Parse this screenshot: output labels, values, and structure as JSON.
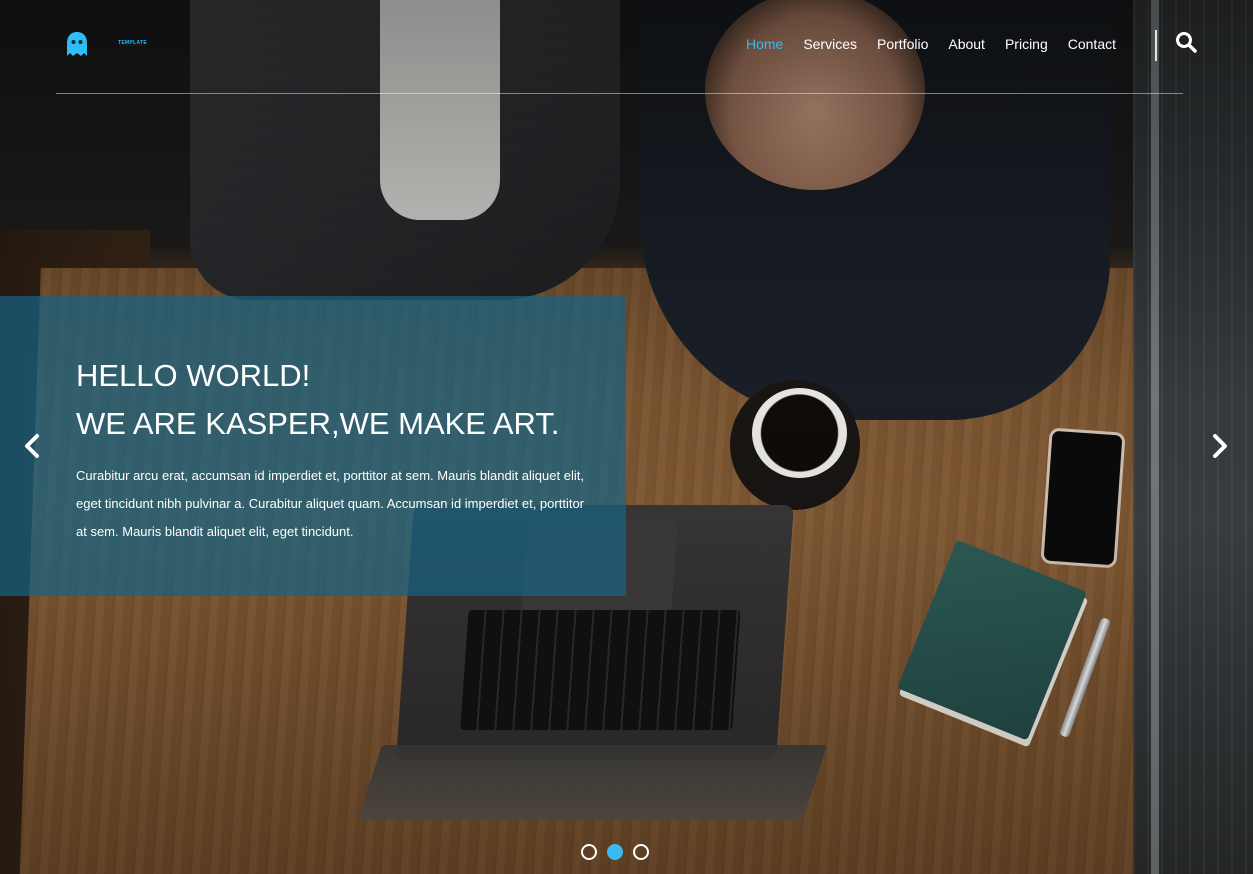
{
  "header": {
    "logo": {
      "text": "TEMPLATE",
      "icon": "ghost-icon",
      "color": "#2fbdf5"
    },
    "nav": [
      {
        "label": "Home",
        "active": true
      },
      {
        "label": "Services",
        "active": false
      },
      {
        "label": "Portfolio",
        "active": false
      },
      {
        "label": "About",
        "active": false
      },
      {
        "label": "Pricing",
        "active": false
      },
      {
        "label": "Contact",
        "active": false
      }
    ],
    "search_icon": "search-icon"
  },
  "hero": {
    "title_line1": "HELLO WORLD!",
    "title_line2": "WE ARE KASPER,WE MAKE ART.",
    "paragraph": "Curabitur arcu erat, accumsan id imperdiet et, porttitor at sem. Mauris blandit aliquet elit, eget tincidunt nibh pulvinar a. Curabitur aliquet quam. Accumsan id imperdiet et, porttitor at sem. Mauris blandit aliquet elit, eget tincidunt.",
    "prev_icon": "chevron-left-icon",
    "next_icon": "chevron-right-icon",
    "slides": 3,
    "active_slide": 2
  },
  "colors": {
    "accent": "#3cb9f0",
    "caption_bg": "rgba(24, 98, 130, 0.72)"
  }
}
